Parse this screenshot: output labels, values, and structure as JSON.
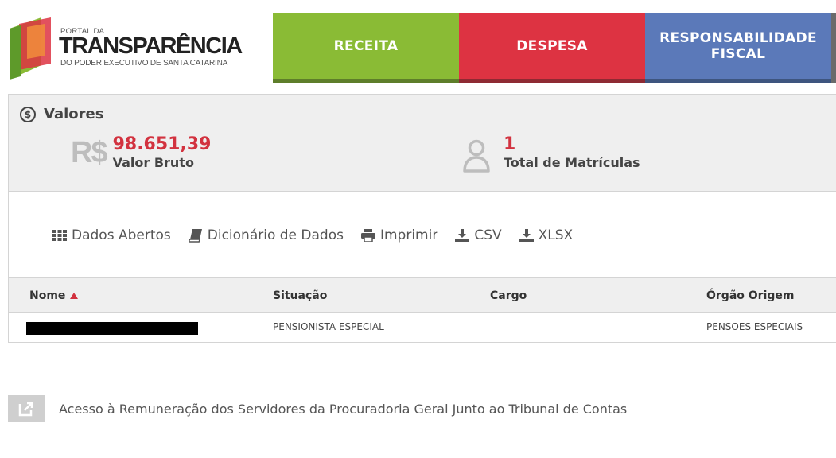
{
  "header": {
    "logo": {
      "line1": "PORTAL DA",
      "line2": "TRANSPARÊNCIA",
      "line3": "DO PODER EXECUTIVO DE SANTA CATARINA"
    },
    "tabs": [
      {
        "label": "RECEITA",
        "color": "#8abb35"
      },
      {
        "label": "DESPESA",
        "color": "#dd3342"
      },
      {
        "label": "RESPONSABILIDADE FISCAL",
        "color": "#5b79b9"
      }
    ]
  },
  "valores": {
    "title": "Valores",
    "icon": "dollar-circle-icon",
    "stats": [
      {
        "icon_text": "R$",
        "value": "98.651,39",
        "label": "Valor Bruto"
      },
      {
        "icon": "user-icon",
        "value": "1",
        "label": "Total de Matrículas"
      }
    ],
    "accent": "#d2323f"
  },
  "toolbar": {
    "items": [
      {
        "label": "Dados Abertos",
        "icon": "grid-icon"
      },
      {
        "label": "Dicionário de Dados",
        "icon": "book-icon"
      },
      {
        "label": "Imprimir",
        "icon": "print-icon"
      },
      {
        "label": "CSV",
        "icon": "download-icon"
      },
      {
        "label": "XLSX",
        "icon": "download-icon"
      }
    ]
  },
  "table": {
    "columns": [
      "Nome",
      "Situação",
      "Cargo",
      "Órgão Origem"
    ],
    "sorted_column": "Nome",
    "sort_direction": "asc",
    "rows": [
      {
        "nome": "",
        "situacao": "PENSIONISTA ESPECIAL",
        "cargo": "",
        "orgao": "PENSOES ESPECIAIS"
      }
    ]
  },
  "footer": {
    "link_text": "Acesso à Remuneração dos Servidores da Procuradoria Geral Junto ao Tribunal de Contas",
    "icon": "external-link-icon"
  }
}
